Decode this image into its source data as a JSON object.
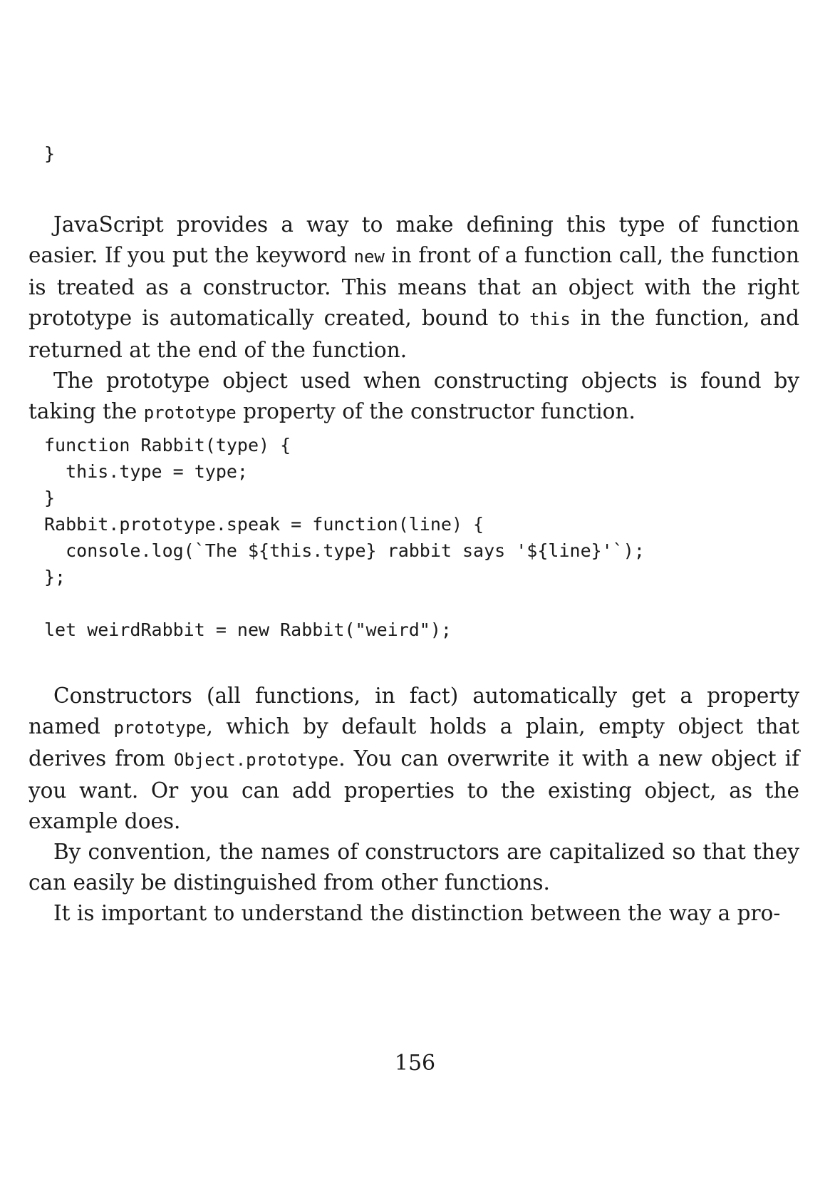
{
  "code_fragment_top": "}",
  "paragraph_1": {
    "t1": "JavaScript provides a way to make defining this type of function easier. If you put the keyword ",
    "c1": "new",
    "t2": " in front of a function call, the function is treated as a constructor. This means that an object with the right prototype is automatically created, bound to ",
    "c2": "this",
    "t3": " in the function, and returned at the end of the function."
  },
  "paragraph_2": {
    "t1": "The prototype object used when constructing objects is found by taking the ",
    "c1": "prototype",
    "t2": " property of the constructor function."
  },
  "code_block": [
    "function Rabbit(type) {",
    "  this.type = type;",
    "}",
    "Rabbit.prototype.speak = function(line) {",
    "  console.log(`The ${this.type} rabbit says '${line}'`);",
    "};",
    "",
    "let weirdRabbit = new Rabbit(\"weird\");"
  ],
  "paragraph_3": {
    "t1": "Constructors (all functions, in fact) automatically get a property named ",
    "c1": "prototype",
    "t2": ", which by default holds a plain, empty object that derives from ",
    "c2": "Object.prototype",
    "t3": ". You can overwrite it with a new object if you want. Or you can add properties to the existing object, as the example does."
  },
  "paragraph_4": "By convention, the names of constructors are capitalized so that they can easily be distinguished from other functions.",
  "paragraph_5": "It is important to understand the distinction between the way a pro-",
  "page_number": "156"
}
